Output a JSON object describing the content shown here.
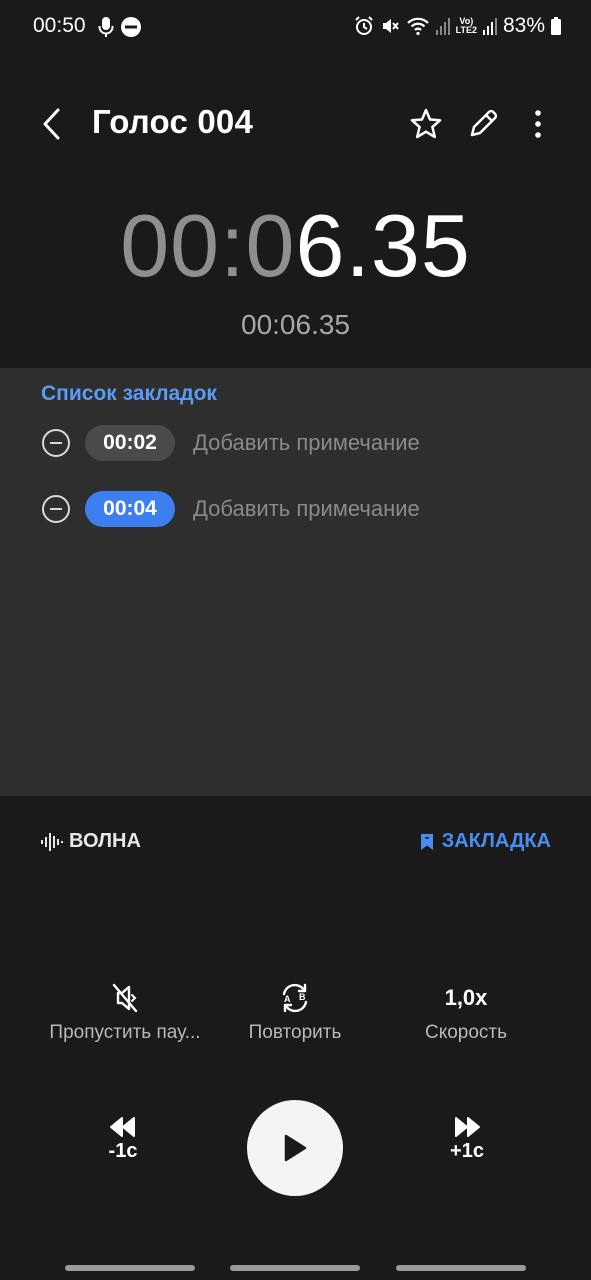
{
  "status": {
    "time": "00:50",
    "battery": "83%",
    "network_label_top": "Vo)",
    "network_label_bottom": "LTE2"
  },
  "header": {
    "title": "Голос 004"
  },
  "timer": {
    "main_dim": "00:0",
    "main_bright": "6.35",
    "total": "00:06.35"
  },
  "bookmarks": {
    "title": "Список закладок",
    "items": [
      {
        "time": "00:02",
        "note_placeholder": "Добавить примечание",
        "active": false
      },
      {
        "time": "00:04",
        "note_placeholder": "Добавить примечание",
        "active": true
      }
    ]
  },
  "tabs": {
    "wave_label": "ВОЛНА",
    "bookmark_label": "ЗАКЛАДКА"
  },
  "controls": {
    "skip_silence_label": "Пропустить пау...",
    "repeat_label": "Повторить",
    "speed_value": "1,0x",
    "speed_label": "Скорость",
    "rewind_label": "-1с",
    "forward_label": "+1с"
  },
  "colors": {
    "accent": "#4a8df0",
    "bookmark_title": "#5a9bf5",
    "chip_inactive": "#4a4a4a",
    "chip_active": "#3d7ff0",
    "panel_bg": "#2e2e2e",
    "page_bg": "#1a1a1a"
  },
  "icons": {
    "back": "chevron-left-icon",
    "favorite": "star-icon",
    "edit": "pencil-icon",
    "more": "more-vertical-icon",
    "play": "play-icon"
  }
}
